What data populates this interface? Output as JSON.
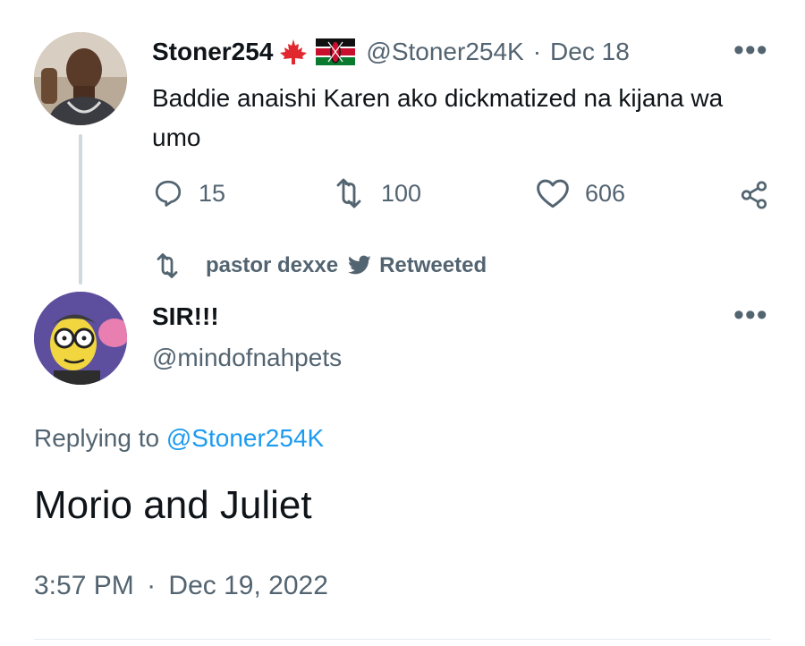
{
  "original_tweet": {
    "display_name": "Stoner254",
    "flags": [
      "canada-flag-icon",
      "kenya-flag-icon"
    ],
    "handle": "@Stoner254K",
    "separator": "·",
    "date": "Dec 18",
    "text": "Baddie anaishi Karen ako dickmatized na kijana wa umo",
    "actions": {
      "reply_count": "15",
      "retweet_count": "100",
      "like_count": "606"
    }
  },
  "retweet_context": {
    "retweeter": "pastor dexxe",
    "label": "Retweeted"
  },
  "reply_tweet": {
    "display_name": "SIR!!!",
    "handle": "@mindofnahpets",
    "replying_prefix": "Replying to",
    "replying_handle": "@Stoner254K",
    "text": "Morio and Juliet",
    "time": "3:57 PM",
    "separator": "·",
    "date": "Dec 19, 2022"
  },
  "more_label": "•••",
  "colors": {
    "text": "#0f1419",
    "secondary": "#536471",
    "link": "#1d9bf0",
    "thread_line": "#cfd9de"
  }
}
